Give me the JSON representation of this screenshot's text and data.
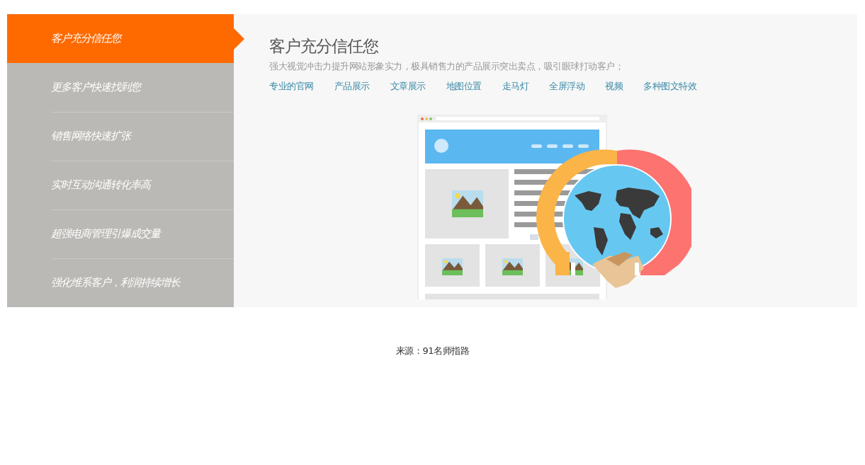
{
  "tabs": [
    {
      "label": "客户充分信任您",
      "selected": true
    },
    {
      "label": "更多客户快速找到您",
      "selected": false
    },
    {
      "label": "销售网络快速扩张",
      "selected": false
    },
    {
      "label": "实时互动沟通转化率高",
      "selected": false
    },
    {
      "label": "超强电商管理引爆成交量",
      "selected": false
    },
    {
      "label": "强化维系客户，利润持续增长",
      "selected": false
    }
  ],
  "panel": {
    "title": "客户充分信任您",
    "description": "强大视觉冲击力提升网站形象实力，极具销售力的产品展示突出卖点，吸引眼球打动客户；",
    "links": [
      "专业的官网",
      "产品展示",
      "文章展示",
      "地图位置",
      "走马灯",
      "全屏浮动",
      "视频",
      "多种图文特效"
    ]
  },
  "source": "来源：91名师指路"
}
